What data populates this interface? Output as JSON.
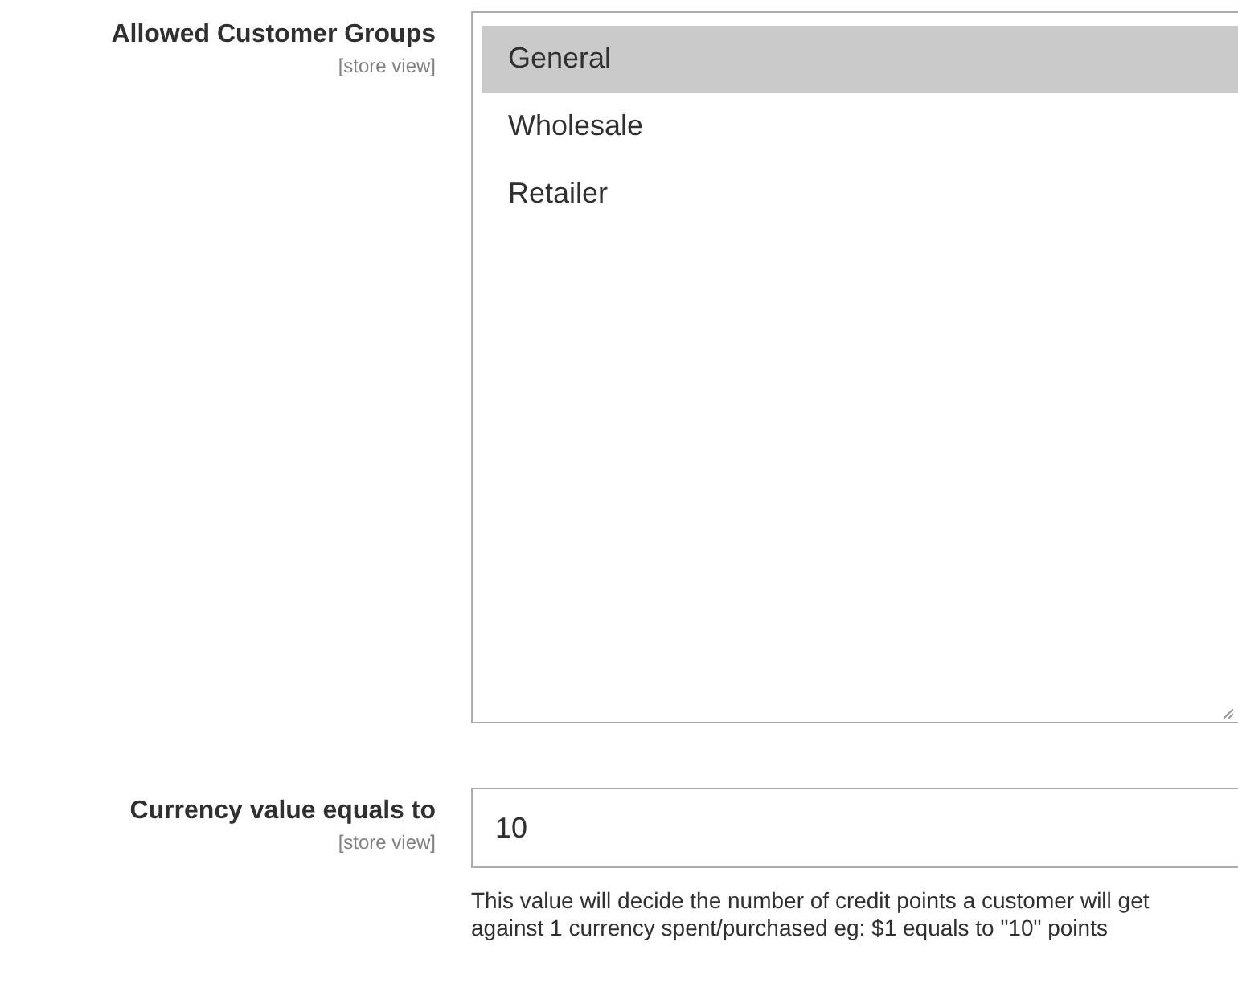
{
  "fields": [
    {
      "kind": "multiselect",
      "label": "Allowed Customer Groups",
      "scope": "[store view]",
      "options": [
        {
          "label": "General",
          "selected": true
        },
        {
          "label": "Wholesale",
          "selected": false
        },
        {
          "label": "Retailer",
          "selected": false
        }
      ]
    },
    {
      "kind": "text",
      "label": "Currency value equals to",
      "scope": "[store view]",
      "value": "10",
      "note": "This value will decide the number of credit points a customer will get against 1 currency spent/purchased eg: $1 equals to \"10\" points"
    }
  ]
}
